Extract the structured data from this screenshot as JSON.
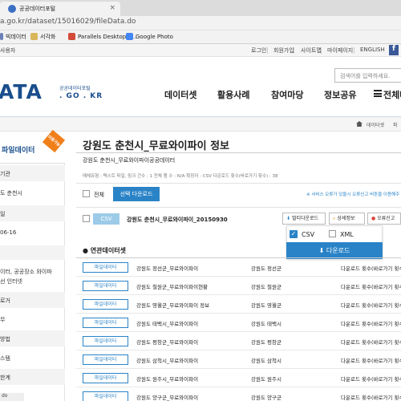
{
  "browser": {
    "tab_title": "공공데이터포털",
    "tab_close": "×",
    "address": "a.go.kr/dataset/15016029/fileData.do",
    "bookmarks": [
      "빅데이터",
      "서각화",
      "Parallels Desktop 1...",
      "Google Photo"
    ]
  },
  "util": {
    "left_text": "사용자",
    "links": [
      "로그인",
      "회원가입",
      "사이트맵",
      "마이페이지",
      "ENGLISH"
    ],
    "facebook": "f"
  },
  "header": {
    "logo_main": "ATA",
    "logo_sub1": "공공데이터포털",
    "logo_sub2": ". GO . KR",
    "search_placeholder": "검색어를 입력하세요.",
    "nav": [
      "데이터셋",
      "활용사례",
      "참여마당",
      "정보공유",
      "전체메"
    ]
  },
  "breadcrumb": [
    "데이터셋",
    "파"
  ],
  "sidebar": {
    "title": "파일데이터",
    "badge": "이용가능",
    "rows": [
      "기관",
      "도 춘천시",
      "일",
      "06-16",
      "",
      "이터, 공공장소 와이파",
      "선 인터넷",
      "",
      "로거",
      "무",
      "",
      "방법",
      "스템",
      "한계"
    ]
  },
  "main": {
    "title": "강원도 춘천시_무료와이파이 정보",
    "description": "강원도 춘천시_무료와이파이공공데이터",
    "meta": "매체유형 : 텍스트     파일, 링크 건수 : 1     전체 행 수 : N/A     확장자 : CSV     다운로드 횟수(바로가기 횟수) : 38",
    "select_all_label": "전체",
    "select_download_label": "선택 다운로드",
    "notice": "※ 서비스 오류가 있을시 오류신고 버튼을 이용해주"
  },
  "file": {
    "tag": "CSV",
    "name": "강원도 춘천시_무료와이파이_20150930",
    "buttons": {
      "multi": "멀티다운로드",
      "detail": "상세정보",
      "report": "오류신고"
    }
  },
  "dropdown": {
    "csv": "CSV",
    "xml": "XML",
    "download": "다운로드"
  },
  "related": {
    "title": "연관데이터셋",
    "button_label": "파일데이터",
    "rows": [
      {
        "name": "강원도 정선군_무료와이파이",
        "org": "강원도 정선군",
        "count": "다운로드 횟수(바로가기 횟수"
      },
      {
        "name": "강원도 철원군_무료와이파이현황",
        "org": "강원도 철원군",
        "count": "다운로드 횟수(바로가기 횟수"
      },
      {
        "name": "강원도 영월군_무료와이파이 정보",
        "org": "강원도 영월군",
        "count": "다운로드 횟수(바로가기 횟수"
      },
      {
        "name": "강원도 태백시_무료와이파이",
        "org": "강원도 태백시",
        "count": "다운로드 횟수(바로가기 횟수"
      },
      {
        "name": "강원도 평창군_무료와이파이",
        "org": "강원도 평창군",
        "count": "다운로드 횟수(바로가기 횟수"
      },
      {
        "name": "강원도 삼척시_무료와이파이",
        "org": "강원도 삼척시",
        "count": "다운로드 횟수(바로가기 횟수"
      },
      {
        "name": "강원도 원주시_무료와이파이",
        "org": "강원도 원주시",
        "count": "다운로드 횟수(바로가기 횟수"
      },
      {
        "name": "강원도 양구군_무료와이파이",
        "org": "강원도 양구군",
        "count": "다운로드 횟수(바로가기 횟수"
      }
    ]
  },
  "status": "do"
}
